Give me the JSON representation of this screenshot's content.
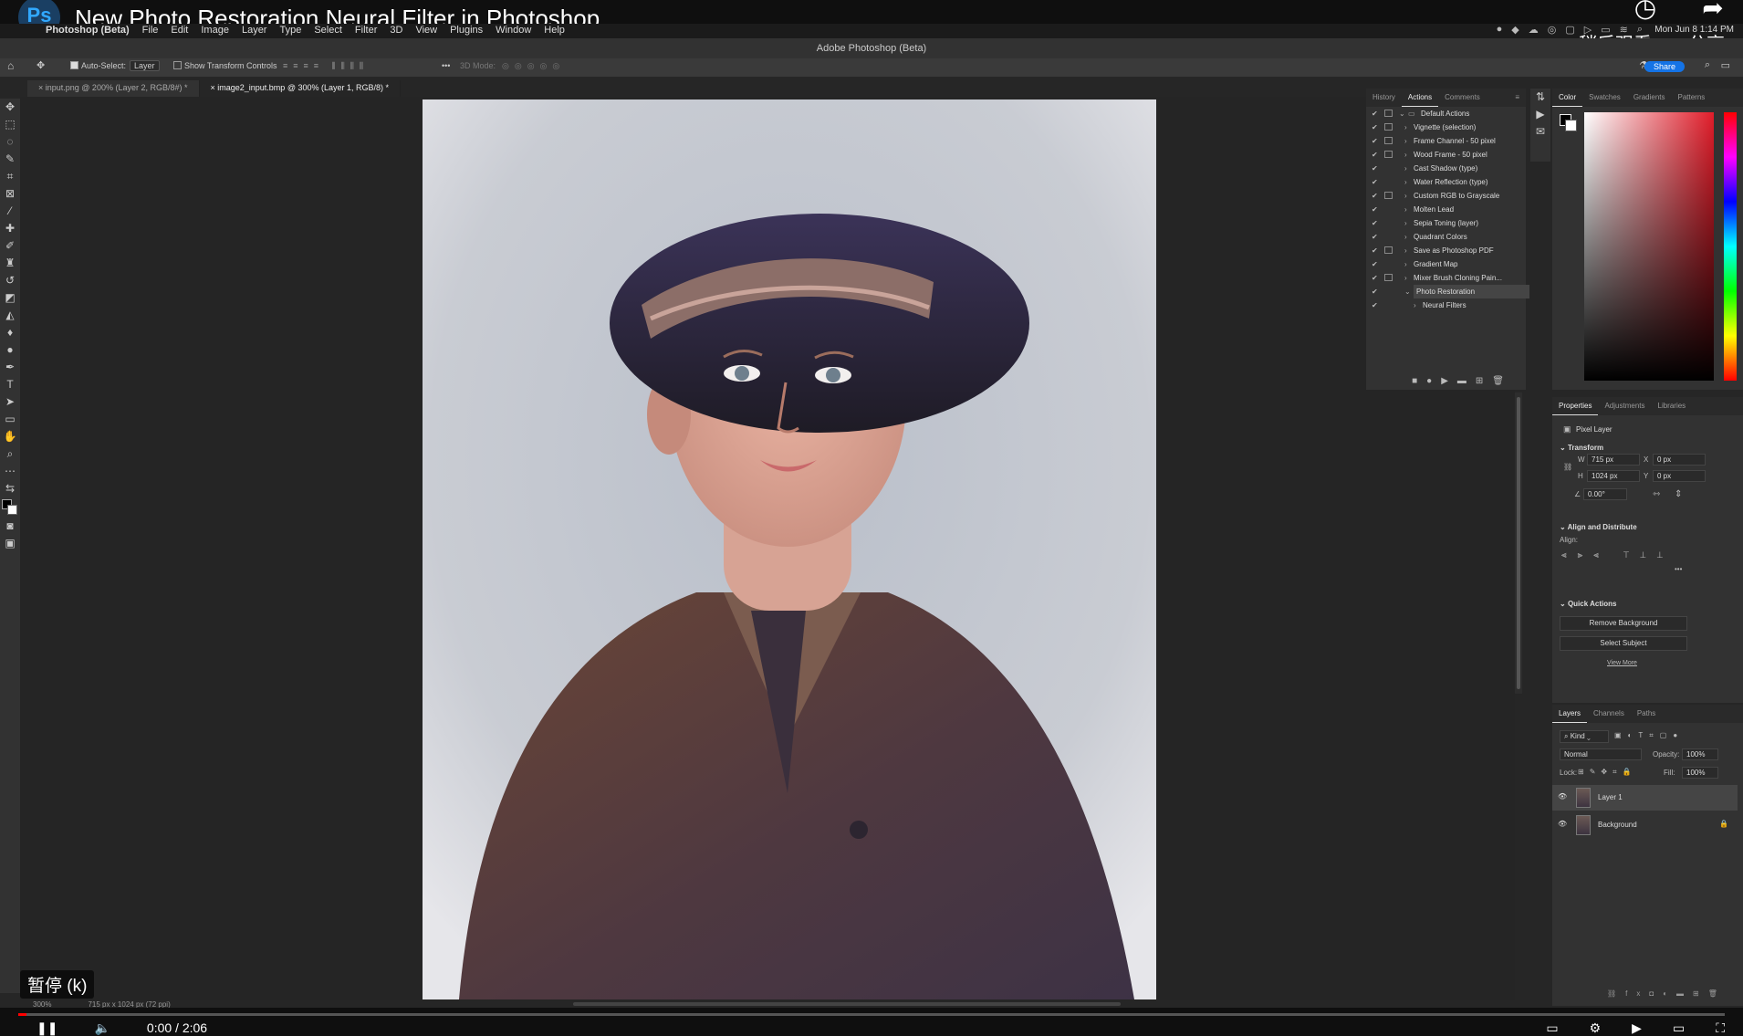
{
  "youtube": {
    "video_title": "New Photo Restoration Neural Filter in Photoshop",
    "logo_text": "Ps",
    "watch_later": "稍后观看",
    "share": "分享",
    "pause_hint": "暂停 (k)",
    "time": "0:00 / 2:06",
    "progress": 0.005
  },
  "mac_menu": [
    "Photoshop (Beta)",
    "File",
    "Edit",
    "Image",
    "Layer",
    "Type",
    "Select",
    "Filter",
    "3D",
    "View",
    "Plugins",
    "Window",
    "Help"
  ],
  "clock": "Mon Jun 8 1:14 PM",
  "window_title": "Adobe Photoshop (Beta)",
  "options_bar": {
    "auto_select_label": "Auto-Select:",
    "auto_select_value": "Layer",
    "show_transform": "Show Transform Controls",
    "three_d_mode": "3D Mode:",
    "share_label": "Share"
  },
  "tabs": [
    {
      "label": "input.png @ 200% (Layer 2, RGB/8#) *",
      "active": false
    },
    {
      "label": "image2_input.bmp @ 300% (Layer 1, RGB/8) *",
      "active": true
    }
  ],
  "actions_panel": {
    "tabs": [
      "History",
      "Actions",
      "Comments"
    ],
    "active_tab": "Actions",
    "items": [
      {
        "label": "Default Actions",
        "folder": true,
        "expanded": true
      },
      {
        "label": "Vignette (selection)"
      },
      {
        "label": "Frame Channel - 50 pixel"
      },
      {
        "label": "Wood Frame - 50 pixel"
      },
      {
        "label": "Cast Shadow (type)"
      },
      {
        "label": "Water Reflection (type)"
      },
      {
        "label": "Custom RGB to Grayscale"
      },
      {
        "label": "Molten Lead"
      },
      {
        "label": "Sepia Toning (layer)"
      },
      {
        "label": "Quadrant Colors"
      },
      {
        "label": "Save as Photoshop PDF"
      },
      {
        "label": "Gradient Map"
      },
      {
        "label": "Mixer Brush Cloning Pain..."
      },
      {
        "label": "Photo Restoration",
        "expanded": true,
        "highlight": true
      },
      {
        "label": "Neural Filters",
        "child": true
      }
    ]
  },
  "color_panel": {
    "tabs": [
      "Color",
      "Swatches",
      "Gradients",
      "Patterns"
    ],
    "active_tab": "Color",
    "hue_color": "#e11d2a"
  },
  "properties_panel": {
    "tabs": [
      "Properties",
      "Adjustments",
      "Libraries"
    ],
    "active_tab": "Properties",
    "layer_type": "Pixel Layer",
    "transform_title": "Transform",
    "w_label": "W",
    "w_value": "715 px",
    "h_label": "H",
    "h_value": "1024 px",
    "x_label": "X",
    "x_value": "0 px",
    "y_label": "Y",
    "y_value": "0 px",
    "angle_value": "0.00°",
    "align_title": "Align and Distribute",
    "align_label": "Align:",
    "quick_actions_title": "Quick Actions",
    "remove_bg": "Remove Background",
    "select_subject": "Select Subject",
    "view_more": "View More"
  },
  "layers_panel": {
    "tabs": [
      "Layers",
      "Channels",
      "Paths"
    ],
    "active_tab": "Layers",
    "kind": "Kind",
    "blend_mode": "Normal",
    "opacity_label": "Opacity:",
    "opacity_value": "100%",
    "lock_label": "Lock:",
    "fill_label": "Fill:",
    "fill_value": "100%",
    "layers": [
      {
        "name": "Layer 1",
        "selected": true,
        "locked": false
      },
      {
        "name": "Background",
        "selected": false,
        "locked": true
      }
    ]
  },
  "doc_status": {
    "zoom": "300%",
    "dimensions": "715 px x 1024 px (72 ppi)"
  }
}
